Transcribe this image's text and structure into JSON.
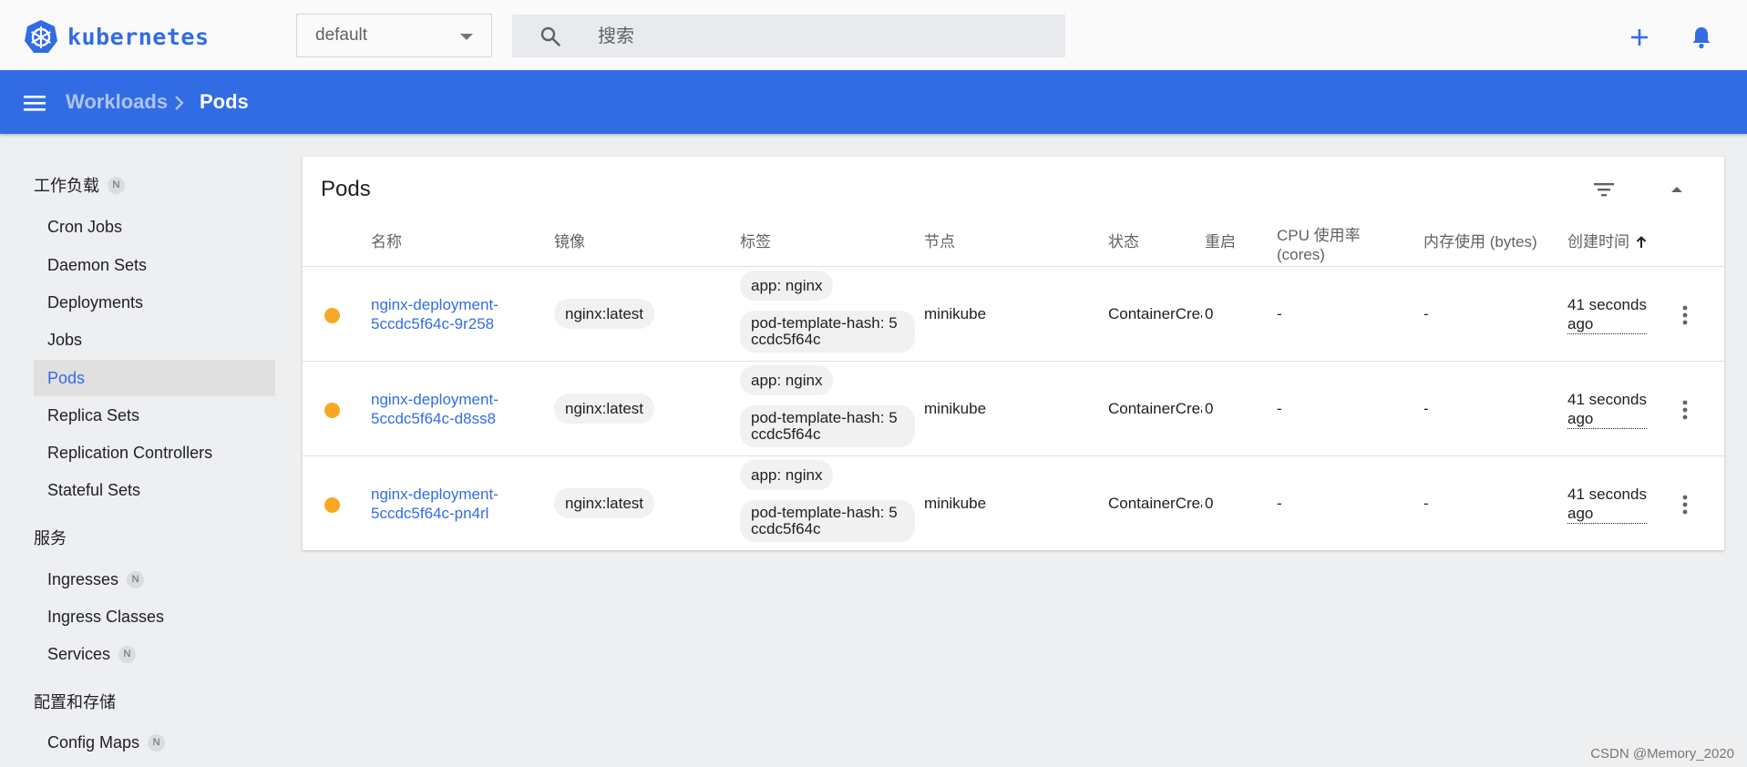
{
  "app": {
    "logo_text": "kubernetes",
    "namespace": "default",
    "search_placeholder": "搜索"
  },
  "breadcrumb": {
    "parent": "Workloads",
    "current": "Pods"
  },
  "sidebar": {
    "sections": [
      {
        "title": "工作负载",
        "badge": "N"
      },
      {
        "title": "服务"
      },
      {
        "title": "配置和存储"
      }
    ],
    "workloads": [
      "Cron Jobs",
      "Daemon Sets",
      "Deployments",
      "Jobs",
      "Pods",
      "Replica Sets",
      "Replication Controllers",
      "Stateful Sets"
    ],
    "active": "Pods",
    "services": [
      {
        "label": "Ingresses",
        "badge": "N"
      },
      {
        "label": "Ingress Classes"
      },
      {
        "label": "Services",
        "badge": "N"
      }
    ],
    "config": [
      {
        "label": "Config Maps",
        "badge": "N"
      }
    ]
  },
  "pods_card": {
    "title": "Pods",
    "columns": {
      "name": "名称",
      "image": "镜像",
      "labels": "标签",
      "node": "节点",
      "status": "状态",
      "restarts": "重启",
      "cpu_line1": "CPU 使用率",
      "cpu_line2": "(cores)",
      "memory": "内存使用 (bytes)",
      "created": "创建时间"
    },
    "rows": [
      {
        "name_line1": "nginx-deployment-",
        "name_line2": "5ccdc5f64c-9r258",
        "image": "nginx:latest",
        "label1": "app: nginx",
        "label2_line1": "pod-template-hash: 5",
        "label2_line2": "ccdc5f64c",
        "node": "minikube",
        "status": "ContainerCreating",
        "restarts": "0",
        "cpu": "-",
        "memory": "-",
        "created_line1": "41 seconds",
        "created_line2": "ago",
        "status_color": "#f9a825"
      },
      {
        "name_line1": "nginx-deployment-",
        "name_line2": "5ccdc5f64c-d8ss8",
        "image": "nginx:latest",
        "label1": "app: nginx",
        "label2_line1": "pod-template-hash: 5",
        "label2_line2": "ccdc5f64c",
        "node": "minikube",
        "status": "ContainerCreating",
        "restarts": "0",
        "cpu": "-",
        "memory": "-",
        "created_line1": "41 seconds",
        "created_line2": "ago",
        "status_color": "#f9a825"
      },
      {
        "name_line1": "nginx-deployment-",
        "name_line2": "5ccdc5f64c-pn4rl",
        "image": "nginx:latest",
        "label1": "app: nginx",
        "label2_line1": "pod-template-hash: 5",
        "label2_line2": "ccdc5f64c",
        "node": "minikube",
        "status": "ContainerCreating",
        "restarts": "0",
        "cpu": "-",
        "memory": "-",
        "created_line1": "41 seconds",
        "created_line2": "ago",
        "status_color": "#f9a825"
      }
    ]
  },
  "watermark": "CSDN @Memory_2020",
  "colors": {
    "brand": "#326ce5",
    "pending": "#f9a825"
  }
}
